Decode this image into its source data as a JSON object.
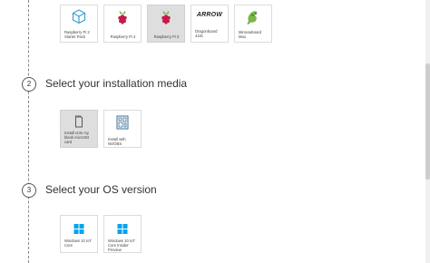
{
  "devices": [
    {
      "label": "Raspberry Pi 2 Starter Pack",
      "icon": "cube-package-icon"
    },
    {
      "label": "Raspberry Pi 2",
      "icon": "raspberry-pi-icon"
    },
    {
      "label": "Raspberry Pi 3",
      "icon": "raspberry-pi-icon"
    },
    {
      "label": "Dragonboard 410c",
      "icon": "arrow-logo-icon",
      "logo_text": "ARROW"
    },
    {
      "label": "Minnowboard Max",
      "icon": "minnow-fish-icon"
    }
  ],
  "steps": [
    {
      "number": "2",
      "title": "Select your installation media",
      "options": [
        {
          "label": "Install onto my blank microSD card",
          "icon": "sd-card-icon"
        },
        {
          "label": "Install with NOOBS",
          "icon": "noobs-board-icon"
        }
      ]
    },
    {
      "number": "3",
      "title": "Select your OS version",
      "options": [
        {
          "label": "Windows 10 IoT Core",
          "icon": "windows-logo-icon"
        },
        {
          "label": "Windows 10 IoT Core Insider Preview",
          "icon": "windows-logo-icon"
        }
      ]
    }
  ],
  "colors": {
    "raspberry_red": "#c51a4a",
    "raspberry_leaf": "#6cc04a",
    "windows_blue": "#00a4ef",
    "cube_blue": "#3aa0d8",
    "selected_bg": "#dedede"
  }
}
